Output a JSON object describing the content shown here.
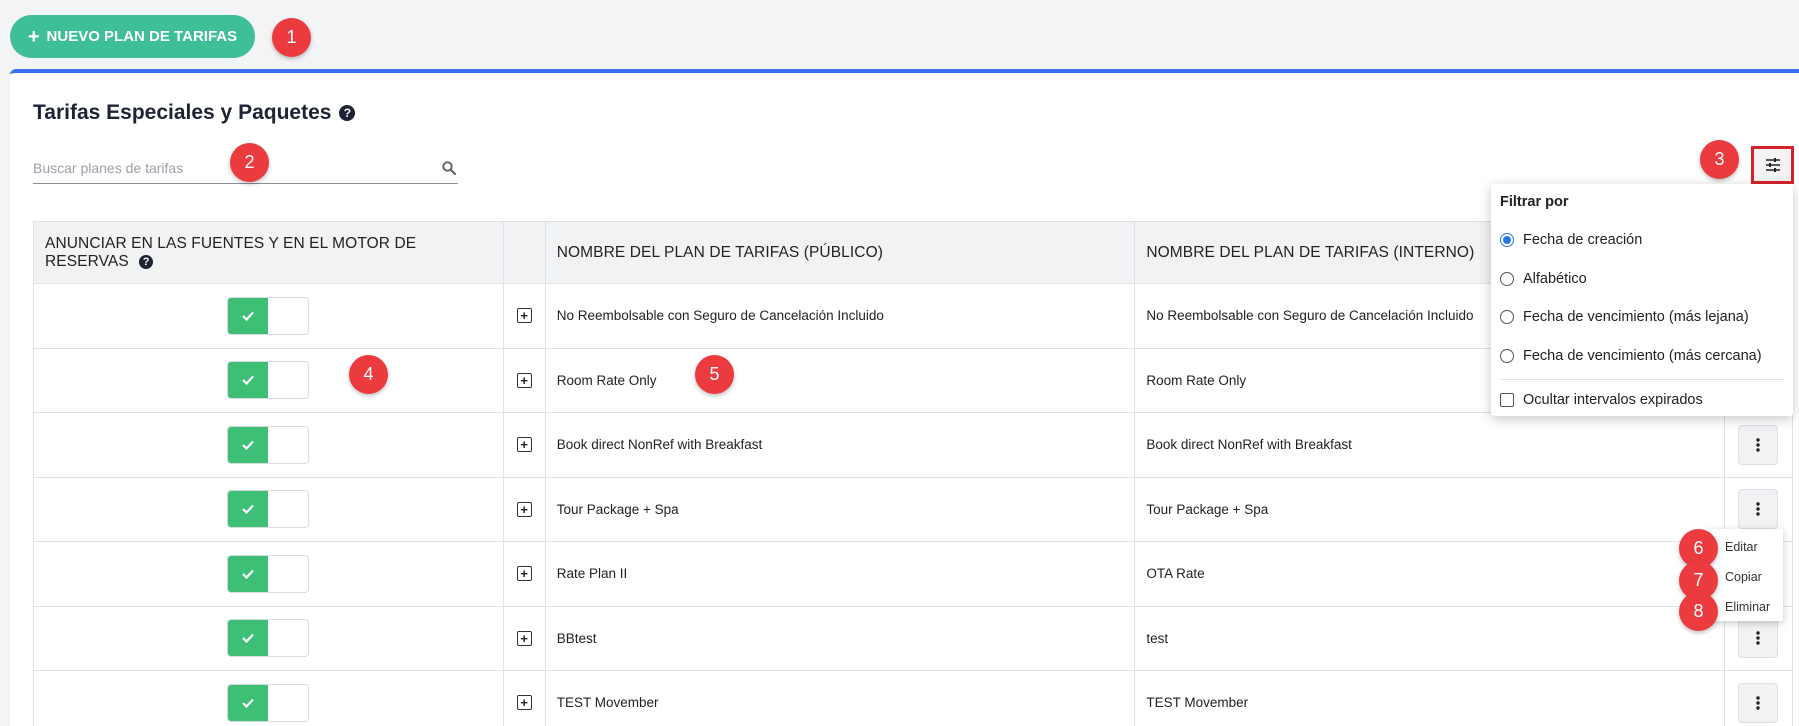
{
  "toolbar": {
    "new_plan_label": "NUEVO PLAN DE TARIFAS"
  },
  "page": {
    "title": "Tarifas Especiales y Paquetes"
  },
  "search": {
    "placeholder": "Buscar planes de tarifas",
    "value": ""
  },
  "table": {
    "headers": {
      "advertise": "ANUNCIAR EN LAS FUENTES Y EN EL MOTOR DE RESERVAS",
      "public_name": "NOMBRE DEL PLAN DE TARIFAS (PÚBLICO)",
      "internal_name": "NOMBRE DEL PLAN DE TARIFAS (INTERNO)"
    },
    "rows": [
      {
        "public": "No Reembolsable con Seguro de Cancelación Incluido",
        "internal": "No Reembolsable con Seguro de Cancelación Incluido",
        "advertised": true
      },
      {
        "public": "Room Rate Only",
        "internal": "Room Rate Only",
        "advertised": true
      },
      {
        "public": "Book direct NonRef with Breakfast",
        "internal": "Book direct NonRef with Breakfast",
        "advertised": true
      },
      {
        "public": "Tour Package + Spa",
        "internal": "Tour Package + Spa",
        "advertised": true
      },
      {
        "public": "Rate Plan II",
        "internal": "OTA Rate",
        "advertised": true
      },
      {
        "public": "BBtest",
        "internal": "test",
        "advertised": true
      },
      {
        "public": "TEST Movember",
        "internal": "TEST Movember",
        "advertised": true
      }
    ]
  },
  "filter": {
    "title": "Filtrar por",
    "options": [
      "Fecha de creación",
      "Alfabético",
      "Fecha de vencimiento (más lejana)",
      "Fecha de vencimiento (más cercana)"
    ],
    "selected": "Fecha de creación",
    "hide_expired_label": "Ocultar intervalos expirados",
    "hide_expired_checked": false
  },
  "action_menu": {
    "items": [
      "Editar",
      "Copiar",
      "Eliminar"
    ]
  },
  "badges": [
    "1",
    "2",
    "3",
    "4",
    "5",
    "6",
    "7",
    "8"
  ],
  "colors": {
    "accent_green": "#3ebf98",
    "toggle_green": "#3ebf76",
    "panel_border": "#3b6ff0",
    "highlight_red": "#d6222b",
    "badge_red": "#eb3b3f",
    "radio_blue": "#2f74e8"
  }
}
